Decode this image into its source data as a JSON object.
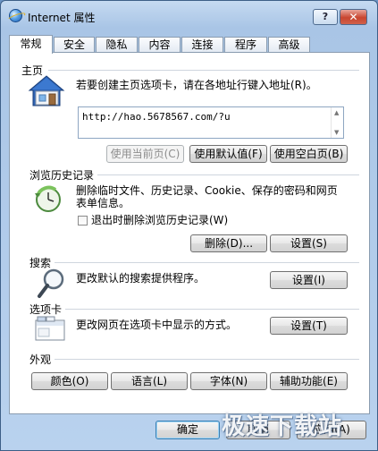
{
  "window": {
    "title": "Internet 属性",
    "help_label": "?",
    "close_label": "✕"
  },
  "tabs": [
    {
      "label": "常规"
    },
    {
      "label": "安全"
    },
    {
      "label": "隐私"
    },
    {
      "label": "内容"
    },
    {
      "label": "连接"
    },
    {
      "label": "程序"
    },
    {
      "label": "高级"
    }
  ],
  "homepage": {
    "title": "主页",
    "description": "若要创建主页选项卡，请在各地址行键入地址(R)。",
    "url": "http://hao.5678567.com/?u",
    "buttons": {
      "use_current": "使用当前页(C)",
      "use_default": "使用默认值(F)",
      "use_blank": "使用空白页(B)"
    }
  },
  "history": {
    "title": "浏览历史记录",
    "description_line1": "删除临时文件、历史记录、Cookie、保存的密码和网页",
    "description_line2": "表单信息。",
    "checkbox_label": "退出时删除浏览历史记录(W)",
    "buttons": {
      "delete": "删除(D)...",
      "settings": "设置(S)"
    }
  },
  "search": {
    "title": "搜索",
    "description": "更改默认的搜索提供程序。",
    "settings": "设置(I)"
  },
  "tabs_section": {
    "title": "选项卡",
    "description": "更改网页在选项卡中显示的方式。",
    "settings": "设置(T)"
  },
  "appearance": {
    "title": "外观",
    "buttons": {
      "colors": "颜色(O)",
      "languages": "语言(L)",
      "fonts": "字体(N)",
      "accessibility": "辅助功能(E)"
    }
  },
  "dialog": {
    "ok": "确定",
    "cancel": "取消",
    "apply": "应用(A)"
  },
  "watermark": "极速下载站"
}
